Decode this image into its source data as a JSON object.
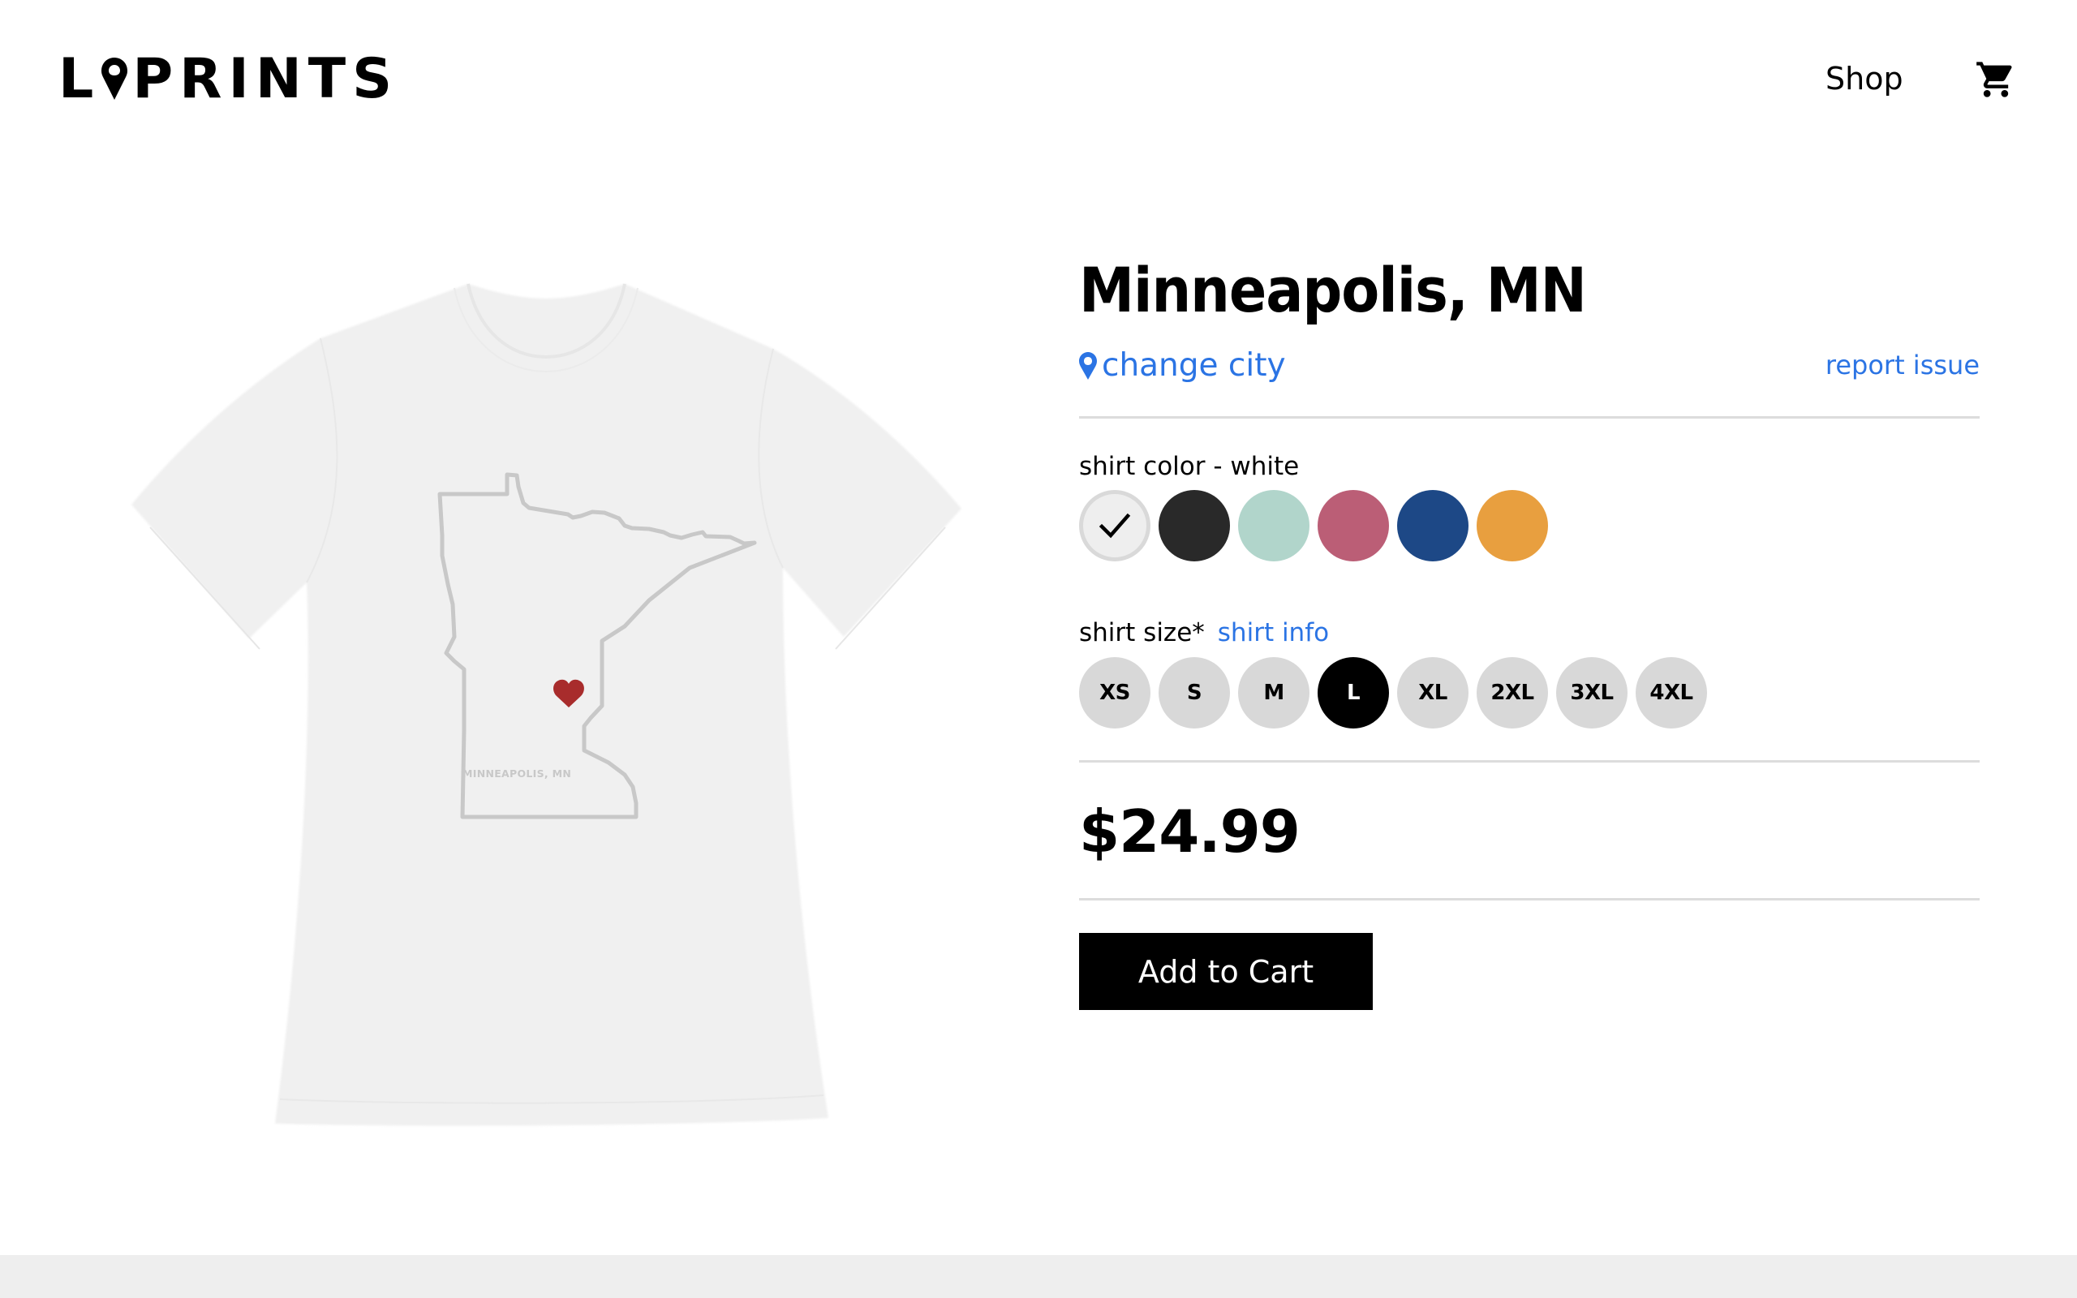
{
  "header": {
    "logo": {
      "first_letter": "L",
      "rest": "PRINTS",
      "pin_icon": "map-pin-icon"
    },
    "nav": {
      "shop_label": "Shop",
      "cart_icon": "shopping-cart-icon"
    }
  },
  "product": {
    "image": {
      "alt": "White t-shirt with Minnesota outline and heart",
      "print_label": "MINNEAPOLIS, MN",
      "heart_color": "#a82c2c",
      "shirt_color": "#f0f0f0",
      "outline_color": "#c8c8c8"
    },
    "title": "Minneapolis, MN",
    "change_city_label": "change city",
    "change_city_icon": "map-pin-icon",
    "report_issue_label": "report issue",
    "color_label_prefix": "shirt color - ",
    "selected_color": "white",
    "colors": [
      {
        "name": "white",
        "hex": "#eeeeee",
        "selected": true
      },
      {
        "name": "black",
        "hex": "#292929",
        "selected": false
      },
      {
        "name": "mint",
        "hex": "#b1d5cb",
        "selected": false
      },
      {
        "name": "berry",
        "hex": "#bb5e76",
        "selected": false
      },
      {
        "name": "navy",
        "hex": "#1d4886",
        "selected": false
      },
      {
        "name": "gold",
        "hex": "#e89f3f",
        "selected": false
      }
    ],
    "size_label": "shirt size*",
    "shirt_info_label": "shirt info",
    "sizes": [
      {
        "label": "XS",
        "selected": false
      },
      {
        "label": "S",
        "selected": false
      },
      {
        "label": "M",
        "selected": false
      },
      {
        "label": "L",
        "selected": true
      },
      {
        "label": "XL",
        "selected": false
      },
      {
        "label": "2XL",
        "selected": false
      },
      {
        "label": "3XL",
        "selected": false
      },
      {
        "label": "4XL",
        "selected": false
      }
    ],
    "price": "$24.99",
    "add_to_cart_label": "Add to Cart"
  },
  "theme": {
    "link_color": "#2b74e4",
    "divider_color": "#dcdcdc",
    "footer_color": "#eeeeee"
  }
}
